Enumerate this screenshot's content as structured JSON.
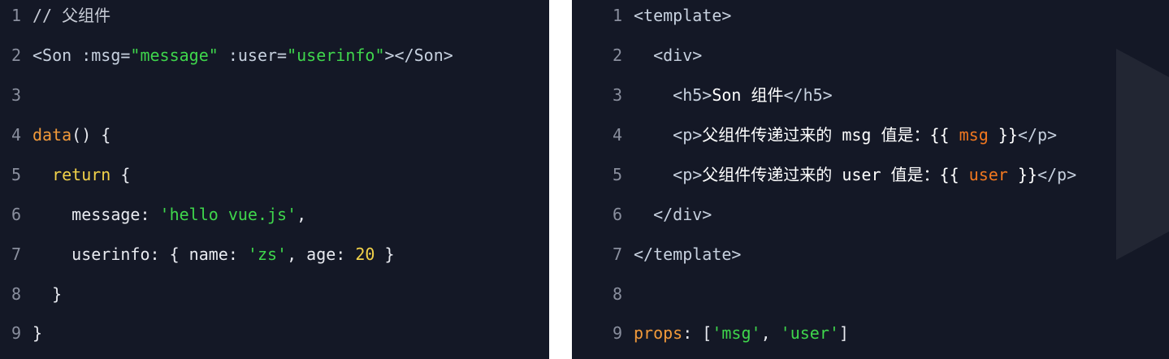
{
  "left_panel": {
    "lines": [
      {
        "num": "1",
        "indent": "",
        "tokens": [
          {
            "t": "// 父组件",
            "c": "comment"
          }
        ]
      },
      {
        "num": "2",
        "indent": "",
        "tokens": [
          {
            "t": "<Son :msg=",
            "c": "tag"
          },
          {
            "t": "\"message\"",
            "c": "string"
          },
          {
            "t": " :user=",
            "c": "attr"
          },
          {
            "t": "\"userinfo\"",
            "c": "string"
          },
          {
            "t": "></Son>",
            "c": "tag"
          }
        ]
      },
      {
        "num": "3",
        "indent": "",
        "tokens": []
      },
      {
        "num": "4",
        "indent": "",
        "tokens": [
          {
            "t": "data",
            "c": "func"
          },
          {
            "t": "() {",
            "c": "punc"
          }
        ]
      },
      {
        "num": "5",
        "indent": "  ",
        "tokens": [
          {
            "t": "return",
            "c": "keyword"
          },
          {
            "t": " {",
            "c": "punc"
          }
        ]
      },
      {
        "num": "6",
        "indent": "    ",
        "tokens": [
          {
            "t": "message: ",
            "c": "prop"
          },
          {
            "t": "'hello vue.js'",
            "c": "string"
          },
          {
            "t": ",",
            "c": "punc"
          }
        ]
      },
      {
        "num": "7",
        "indent": "    ",
        "tokens": [
          {
            "t": "userinfo: { name: ",
            "c": "prop"
          },
          {
            "t": "'zs'",
            "c": "string"
          },
          {
            "t": ", age: ",
            "c": "prop"
          },
          {
            "t": "20",
            "c": "number"
          },
          {
            "t": " }",
            "c": "punc"
          }
        ]
      },
      {
        "num": "8",
        "indent": "  ",
        "tokens": [
          {
            "t": "}",
            "c": "punc"
          }
        ]
      },
      {
        "num": "9",
        "indent": "",
        "tokens": [
          {
            "t": "}",
            "c": "punc"
          }
        ]
      }
    ]
  },
  "right_panel": {
    "lines": [
      {
        "num": "1",
        "indent": "",
        "tokens": [
          {
            "t": "<template>",
            "c": "tag"
          }
        ]
      },
      {
        "num": "2",
        "indent": "  ",
        "tokens": [
          {
            "t": "<div>",
            "c": "tag"
          }
        ]
      },
      {
        "num": "3",
        "indent": "    ",
        "tokens": [
          {
            "t": "<h5>",
            "c": "tag"
          },
          {
            "t": "Son 组件",
            "c": "white"
          },
          {
            "t": "</h5>",
            "c": "tag"
          }
        ]
      },
      {
        "num": "4",
        "indent": "    ",
        "tokens": [
          {
            "t": "<p>",
            "c": "tag"
          },
          {
            "t": "父组件传递过来的 msg 值是：{{ ",
            "c": "white"
          },
          {
            "t": "msg",
            "c": "var"
          },
          {
            "t": " }}",
            "c": "white"
          },
          {
            "t": "</p>",
            "c": "tag"
          }
        ]
      },
      {
        "num": "5",
        "indent": "    ",
        "tokens": [
          {
            "t": "<p>",
            "c": "tag"
          },
          {
            "t": "父组件传递过来的 user 值是：{{ ",
            "c": "white"
          },
          {
            "t": "user",
            "c": "var"
          },
          {
            "t": " }}",
            "c": "white"
          },
          {
            "t": "</p>",
            "c": "tag"
          }
        ]
      },
      {
        "num": "6",
        "indent": "  ",
        "tokens": [
          {
            "t": "</div>",
            "c": "tag"
          }
        ]
      },
      {
        "num": "7",
        "indent": "",
        "tokens": [
          {
            "t": "</template>",
            "c": "tag"
          }
        ]
      },
      {
        "num": "8",
        "indent": "",
        "tokens": []
      },
      {
        "num": "9",
        "indent": "",
        "tokens": [
          {
            "t": "props",
            "c": "key"
          },
          {
            "t": ": [",
            "c": "punc"
          },
          {
            "t": "'msg'",
            "c": "string"
          },
          {
            "t": ", ",
            "c": "punc"
          },
          {
            "t": "'user'",
            "c": "string"
          },
          {
            "t": "]",
            "c": "punc"
          }
        ]
      }
    ]
  },
  "colors": {
    "background": "#141826",
    "string": "#3fd64c",
    "function": "#f29a3a",
    "keyword": "#f2d24a",
    "variable": "#f2781f",
    "line_number": "#8a8f9e"
  }
}
